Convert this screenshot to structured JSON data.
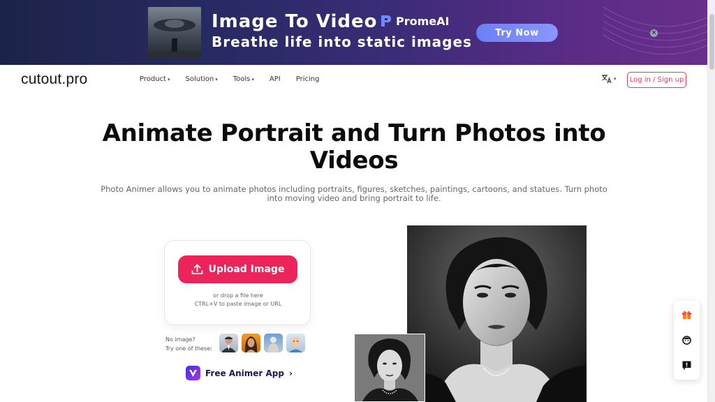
{
  "banner": {
    "title": "Image To Video",
    "subtitle": "Breathe life into static images",
    "brand": "PromeAI",
    "cta": "Try Now",
    "close": "×"
  },
  "nav": {
    "logo": "cutout.pro",
    "items": [
      {
        "label": "Product",
        "dropdown": true
      },
      {
        "label": "Solution",
        "dropdown": true
      },
      {
        "label": "Tools",
        "dropdown": true
      },
      {
        "label": "API",
        "dropdown": false
      },
      {
        "label": "Pricing",
        "dropdown": false
      }
    ],
    "language_icon": "translate-icon",
    "login": "Log in / Sign up"
  },
  "hero": {
    "title_line1": "Animate Portrait and Turn Photos into",
    "title_line2": "Videos",
    "description_line1": "Photo Animer allows you to animate photos including portraits, figures, sketches, paintings, cartoons, and statues. Turn photo",
    "description_line2": "into moving video and bring portrait to life."
  },
  "upload": {
    "button": "Upload Image",
    "hint_line1": "or drop a file here",
    "hint_line2": "CTRL+V to paste image or URL"
  },
  "samples": {
    "label_line1": "No image?",
    "label_line2": "Try one of these:"
  },
  "app_link": {
    "label": "Free Animer App",
    "arrow": "›"
  },
  "colors": {
    "accent": "#ec2459",
    "login_border": "#e8385f",
    "banner_cta": "#7a8cf7"
  },
  "side_float": {
    "icons": [
      "gift-icon",
      "support-agent-icon",
      "feedback-icon"
    ]
  }
}
